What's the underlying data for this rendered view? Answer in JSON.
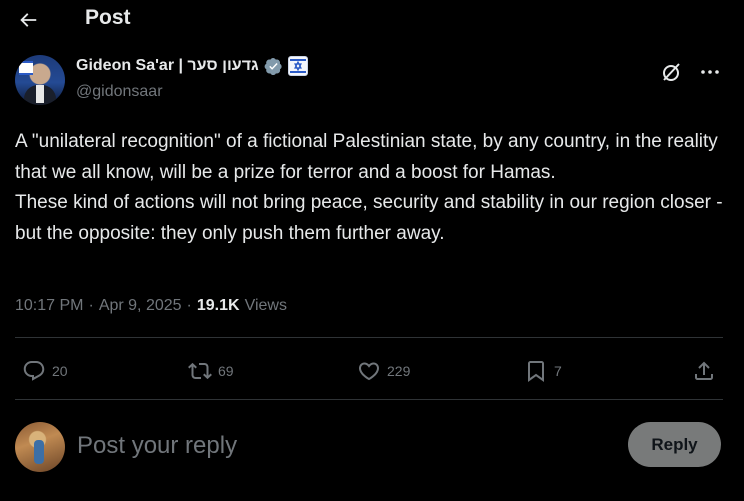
{
  "header": {
    "back_icon": "arrow-left-icon",
    "title": "Post"
  },
  "post": {
    "author": {
      "display_name": "Gideon Sa'ar | גדעון סער",
      "handle": "@gidonsaar",
      "verified_icon": "verified-badge-icon",
      "affiliation_icon": "israel-flag-badge-icon"
    },
    "text": "A \"unilateral recognition\" of a fictional Palestinian state, by any country, in the reality that we all know, will be a prize for terror and a boost for Hamas.\nThese kind of actions will not bring peace, security and stability in our region closer - but the opposite: they only push them further away.",
    "time": "10:17 PM",
    "separator": "·",
    "date": "Apr 9, 2025",
    "views_count": "19.1K",
    "views_label": "Views"
  },
  "actions": {
    "replies": "20",
    "reposts": "69",
    "likes": "229",
    "bookmarks": "7"
  },
  "reply": {
    "placeholder": "Post your reply",
    "button_label": "Reply"
  },
  "colors": {
    "background": "#000000",
    "text_primary": "#e7e9ea",
    "text_secondary": "#71767b",
    "divider": "#2f3336",
    "verified": "#829aab",
    "reply_button_bg": "#787a7a"
  }
}
